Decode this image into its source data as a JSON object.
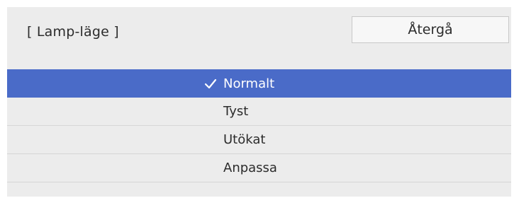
{
  "header": {
    "title": "[ Lamp-läge ]",
    "back_label": "Återgå"
  },
  "options": [
    {
      "label": "Normalt",
      "selected": true,
      "icon": "checkmark-icon"
    },
    {
      "label": "Tyst",
      "selected": false
    },
    {
      "label": "Utökat",
      "selected": false
    },
    {
      "label": "Anpassa",
      "selected": false
    }
  ],
  "colors": {
    "background": "#ececec",
    "selected": "#4a6bc8",
    "text": "#2c2c2c",
    "selected_text": "#ffffff"
  }
}
